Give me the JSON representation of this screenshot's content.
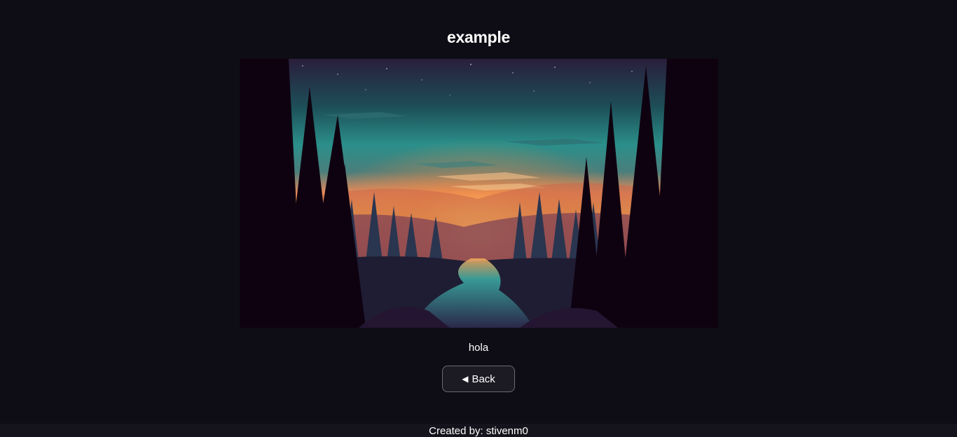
{
  "page": {
    "title": "example",
    "caption": "hola"
  },
  "image": {
    "description_icon": "forest-sunset-illustration"
  },
  "back_button": {
    "icon": "◀",
    "label": "Back"
  },
  "footer": {
    "text": "Created by: stivenm0"
  },
  "colors": {
    "background": "#0e0d15",
    "footer_background": "#15141c",
    "button_border": "#6f6a72",
    "text": "#ffffff"
  }
}
